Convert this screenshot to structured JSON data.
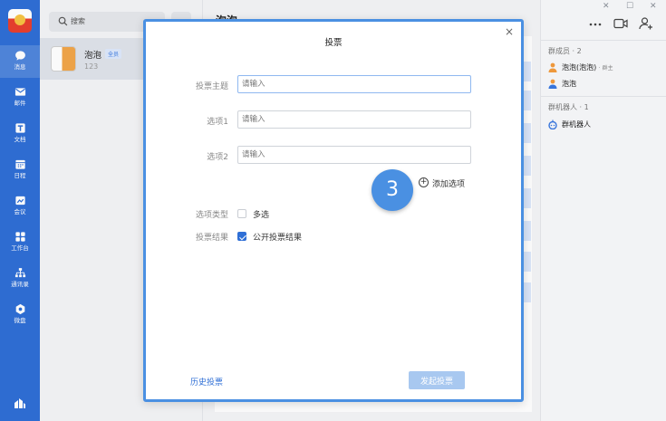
{
  "nav": {
    "items": [
      {
        "label": "消息",
        "icon": "chat-icon"
      },
      {
        "label": "邮件",
        "icon": "mail-icon"
      },
      {
        "label": "文档",
        "icon": "doc-icon"
      },
      {
        "label": "日程",
        "icon": "calendar-icon"
      },
      {
        "label": "会议",
        "icon": "meeting-icon"
      },
      {
        "label": "工作台",
        "icon": "workbench-icon"
      },
      {
        "label": "通讯录",
        "icon": "contacts-icon"
      },
      {
        "label": "微盘",
        "icon": "drive-icon"
      }
    ]
  },
  "search": {
    "placeholder": "搜索"
  },
  "conversation": {
    "name": "泡泡",
    "badge": "全员",
    "preview": "123"
  },
  "chat": {
    "title": "泡泡"
  },
  "right_panel": {
    "members_title": "群成员 · 2",
    "members": [
      {
        "name": "泡泡(泡泡)",
        "role": "· 群主"
      },
      {
        "name": "泡泡",
        "role": ""
      }
    ],
    "bots_title": "群机器人 · 1",
    "bots": [
      {
        "name": "群机器人"
      }
    ]
  },
  "modal": {
    "title": "投票",
    "close": "×",
    "fields": [
      {
        "label": "投票主题",
        "placeholder": "请输入"
      },
      {
        "label": "选项1",
        "placeholder": "请输入"
      },
      {
        "label": "选项2",
        "placeholder": "请输入"
      }
    ],
    "add_option_label": "添加选项",
    "step_number": "3",
    "option_type_label": "选项类型",
    "multi_select_label": "多选",
    "multi_select_checked": false,
    "result_label": "投票结果",
    "public_result_label": "公开投票结果",
    "public_result_checked": true,
    "history_label": "历史投票",
    "submit_label": "发起投票"
  }
}
